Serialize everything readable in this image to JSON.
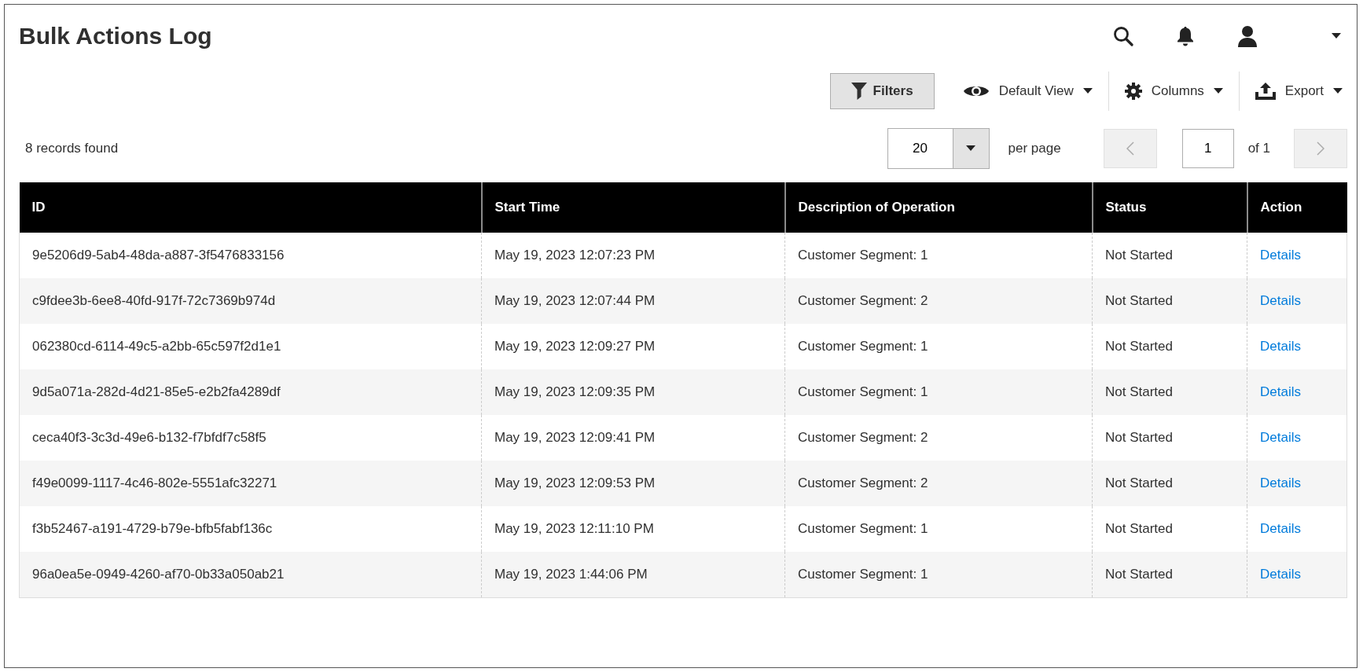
{
  "page": {
    "title": "Bulk Actions Log"
  },
  "toolbar": {
    "filters": "Filters",
    "view": "Default View",
    "columns": "Columns",
    "export": "Export"
  },
  "records": "8 records found",
  "pagination": {
    "per_page_value": "20",
    "per_page_label": "per page",
    "page": "1",
    "of_pages": "of 1"
  },
  "table": {
    "columns": [
      "ID",
      "Start Time",
      "Description of Operation",
      "Status",
      "Action"
    ],
    "rows": [
      {
        "id": "9e5206d9-5ab4-48da-a887-3f5476833156",
        "start": "May 19, 2023 12:07:23 PM",
        "description": "Customer Segment: 1",
        "status": "Not Started",
        "action": "Details"
      },
      {
        "id": "c9fdee3b-6ee8-40fd-917f-72c7369b974d",
        "start": "May 19, 2023 12:07:44 PM",
        "description": "Customer Segment: 2",
        "status": "Not Started",
        "action": "Details"
      },
      {
        "id": "062380cd-6114-49c5-a2bb-65c597f2d1e1",
        "start": "May 19, 2023 12:09:27 PM",
        "description": "Customer Segment: 1",
        "status": "Not Started",
        "action": "Details"
      },
      {
        "id": "9d5a071a-282d-4d21-85e5-e2b2fa4289df",
        "start": "May 19, 2023 12:09:35 PM",
        "description": "Customer Segment: 1",
        "status": "Not Started",
        "action": "Details"
      },
      {
        "id": "ceca40f3-3c3d-49e6-b132-f7bfdf7c58f5",
        "start": "May 19, 2023 12:09:41 PM",
        "description": "Customer Segment: 2",
        "status": "Not Started",
        "action": "Details"
      },
      {
        "id": "f49e0099-1117-4c46-802e-5551afc32271",
        "start": "May 19, 2023 12:09:53 PM",
        "description": "Customer Segment: 2",
        "status": "Not Started",
        "action": "Details"
      },
      {
        "id": "f3b52467-a191-4729-b79e-bfb5fabf136c",
        "start": "May 19, 2023 12:11:10 PM",
        "description": "Customer Segment: 1",
        "status": "Not Started",
        "action": "Details"
      },
      {
        "id": "96a0ea5e-0949-4260-af70-0b33a050ab21",
        "start": "May 19, 2023 1:44:06 PM",
        "description": "Customer Segment: 1",
        "status": "Not Started",
        "action": "Details"
      }
    ]
  }
}
